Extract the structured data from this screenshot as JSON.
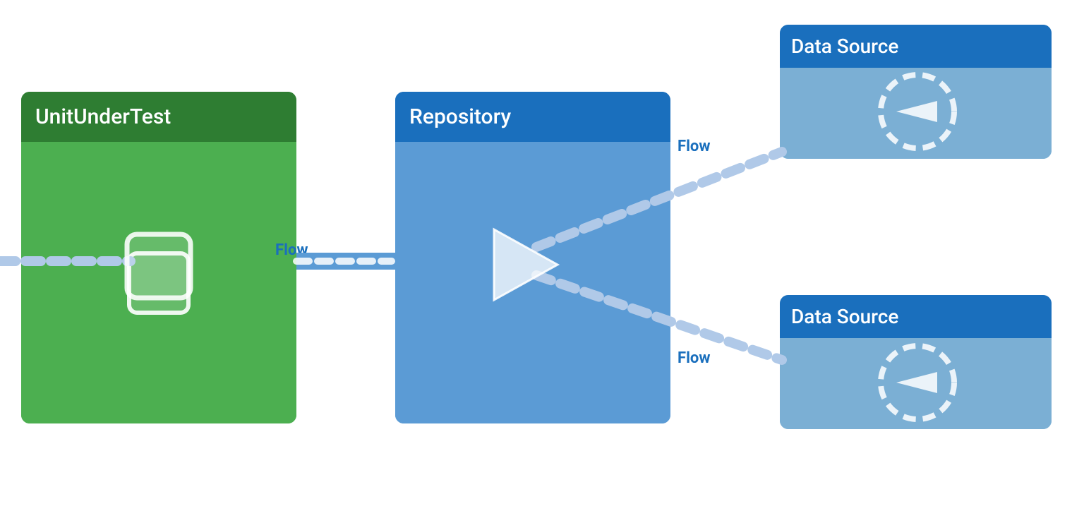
{
  "diagram": {
    "background": "#ffffff",
    "unit_under_test": {
      "title": "UnitUnderTest",
      "header_color": "#2e7d32",
      "body_color": "#4caf50",
      "border_radius": 12,
      "icon": "square"
    },
    "repository": {
      "title": "Repository",
      "header_color": "#1565c0",
      "body_color": "#5b9bd5",
      "border_radius": 12,
      "icon": "triangle"
    },
    "data_sources": [
      {
        "id": "top",
        "title": "Data Source",
        "header_color": "#1565c0",
        "body_color": "#7bafd4",
        "icon": "left-arrow-circle-dashed"
      },
      {
        "id": "bottom",
        "title": "Data Source",
        "header_color": "#1565c0",
        "body_color": "#7bafd4",
        "icon": "left-arrow-circle-dashed"
      }
    ],
    "flows": [
      {
        "id": "unit-to-repo",
        "label": "Flow",
        "label_color": "#1a6fbd"
      },
      {
        "id": "repo-to-datasource-top",
        "label": "Flow",
        "label_color": "#1a6fbd"
      },
      {
        "id": "repo-to-datasource-bottom",
        "label": "Flow",
        "label_color": "#1a6fbd"
      }
    ]
  }
}
